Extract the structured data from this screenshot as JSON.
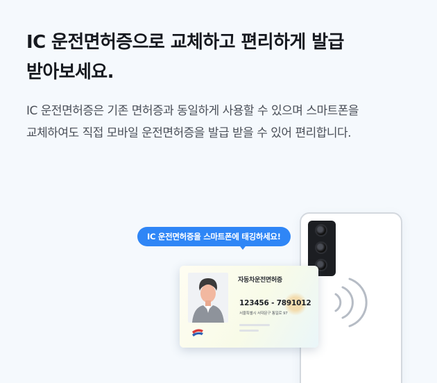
{
  "headline": {
    "line1": "IC 운전면허증으로 교체하고 편리하게 발급",
    "line2": "받아보세요."
  },
  "description": {
    "line1": "IC 운전면허증은 기존 면허증과 동일하게 사용할 수 있으며 스마트폰을",
    "line2": "교체하여도 직접 모바일 운전면허증을 발급 받을 수 있어 편리합니다."
  },
  "illustration": {
    "bubble_text": "IC 운전면허증을 스마트폰에 태깅하세요!",
    "card": {
      "title": "자동차운전면허증",
      "number": "123456 - 7891012",
      "address": "서울특별시 서대문구 통일로 97"
    },
    "colors": {
      "bubble": "#2f86f6",
      "phone_border": "#d3d8de",
      "background": "#f5f9fd"
    },
    "icons": [
      "camera-module-icon",
      "nfc-waves-icon",
      "person-photo-icon",
      "license-logo-icon"
    ]
  }
}
